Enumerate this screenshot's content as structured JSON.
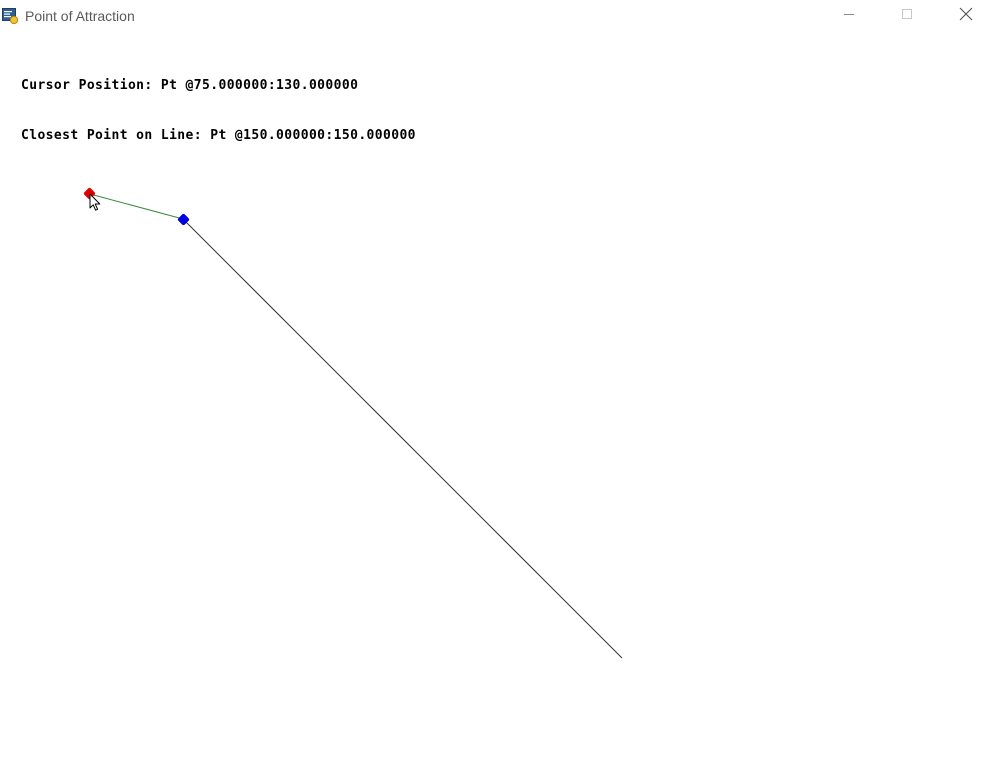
{
  "window": {
    "title": "Point of Attraction",
    "icon": "python-app-icon",
    "controls": [
      "minimize-icon",
      "maximize-icon",
      "close-icon"
    ]
  },
  "readouts": {
    "cursor_label": "Cursor Position:",
    "cursor_value": "Pt @75.000000:130.000000",
    "closest_label": "Closest Point on Line:",
    "closest_value": "Pt @150.000000:150.000000"
  },
  "colors": {
    "cursor_marker": "#e00000",
    "closest_marker": "#0000e0",
    "connector_line": "#3a8a3a",
    "main_line": "#333333"
  }
}
